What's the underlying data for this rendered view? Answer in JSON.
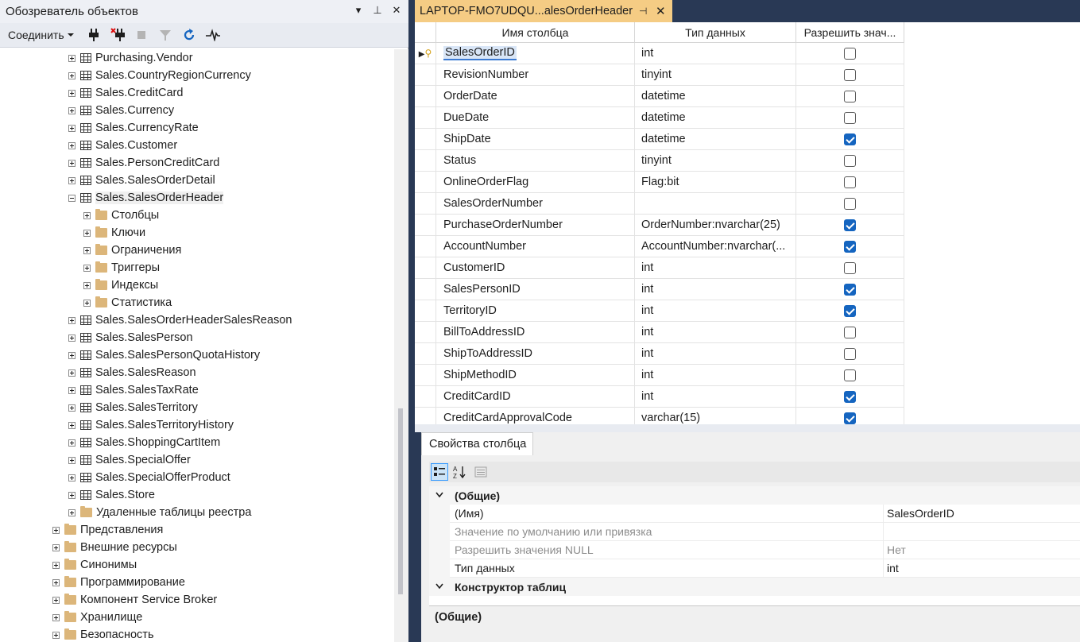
{
  "object_explorer": {
    "title": "Обозреватель объектов",
    "title_actions": [
      "▾",
      "⊥",
      "✕"
    ],
    "toolbar": {
      "connect_label": "Соединить"
    },
    "tree": [
      {
        "label": "Purchasing.Vendor",
        "type": "table",
        "level": 2,
        "expanded": false
      },
      {
        "label": "Sales.CountryRegionCurrency",
        "type": "table",
        "level": 2,
        "expanded": false
      },
      {
        "label": "Sales.CreditCard",
        "type": "table",
        "level": 2,
        "expanded": false
      },
      {
        "label": "Sales.Currency",
        "type": "table",
        "level": 2,
        "expanded": false
      },
      {
        "label": "Sales.CurrencyRate",
        "type": "table",
        "level": 2,
        "expanded": false
      },
      {
        "label": "Sales.Customer",
        "type": "table",
        "level": 2,
        "expanded": false
      },
      {
        "label": "Sales.PersonCreditCard",
        "type": "table",
        "level": 2,
        "expanded": false
      },
      {
        "label": "Sales.SalesOrderDetail",
        "type": "table",
        "level": 2,
        "expanded": false
      },
      {
        "label": "Sales.SalesOrderHeader",
        "type": "table",
        "level": 2,
        "expanded": true,
        "selected": true
      },
      {
        "label": "Столбцы",
        "type": "folder",
        "level": 3,
        "expanded": false
      },
      {
        "label": "Ключи",
        "type": "folder",
        "level": 3,
        "expanded": false
      },
      {
        "label": "Ограничения",
        "type": "folder",
        "level": 3,
        "expanded": false
      },
      {
        "label": "Триггеры",
        "type": "folder",
        "level": 3,
        "expanded": false
      },
      {
        "label": "Индексы",
        "type": "folder",
        "level": 3,
        "expanded": false
      },
      {
        "label": "Статистика",
        "type": "folder",
        "level": 3,
        "expanded": false
      },
      {
        "label": "Sales.SalesOrderHeaderSalesReason",
        "type": "table",
        "level": 2,
        "expanded": false
      },
      {
        "label": "Sales.SalesPerson",
        "type": "table",
        "level": 2,
        "expanded": false
      },
      {
        "label": "Sales.SalesPersonQuotaHistory",
        "type": "table",
        "level": 2,
        "expanded": false
      },
      {
        "label": "Sales.SalesReason",
        "type": "table",
        "level": 2,
        "expanded": false
      },
      {
        "label": "Sales.SalesTaxRate",
        "type": "table",
        "level": 2,
        "expanded": false
      },
      {
        "label": "Sales.SalesTerritory",
        "type": "table",
        "level": 2,
        "expanded": false
      },
      {
        "label": "Sales.SalesTerritoryHistory",
        "type": "table",
        "level": 2,
        "expanded": false
      },
      {
        "label": "Sales.ShoppingCartItem",
        "type": "table",
        "level": 2,
        "expanded": false
      },
      {
        "label": "Sales.SpecialOffer",
        "type": "table",
        "level": 2,
        "expanded": false
      },
      {
        "label": "Sales.SpecialOfferProduct",
        "type": "table",
        "level": 2,
        "expanded": false
      },
      {
        "label": "Sales.Store",
        "type": "table",
        "level": 2,
        "expanded": false
      },
      {
        "label": "Удаленные таблицы реестра",
        "type": "folder",
        "level": 2,
        "expanded": false
      },
      {
        "label": "Представления",
        "type": "folder",
        "level": 1,
        "expanded": false
      },
      {
        "label": "Внешние ресурсы",
        "type": "folder",
        "level": 1,
        "expanded": false
      },
      {
        "label": "Синонимы",
        "type": "folder",
        "level": 1,
        "expanded": false
      },
      {
        "label": "Программирование",
        "type": "folder",
        "level": 1,
        "expanded": false
      },
      {
        "label": "Компонент Service Broker",
        "type": "folder",
        "level": 1,
        "expanded": false
      },
      {
        "label": "Хранилище",
        "type": "folder",
        "level": 1,
        "expanded": false
      },
      {
        "label": "Безопасность",
        "type": "folder",
        "level": 1,
        "expanded": false
      }
    ]
  },
  "document_tab": {
    "title": "LAPTOP-FMO7UDQU...alesOrderHeader",
    "pin_icon": "⊣",
    "close_icon": "✕",
    "accent": "#f5cc84"
  },
  "table_designer": {
    "headers": [
      "Имя столбца",
      "Тип данных",
      "Разрешить знач..."
    ],
    "rows": [
      {
        "name": "SalesOrderID",
        "type": "int",
        "allow_null": false,
        "primary_key": true,
        "editing": true
      },
      {
        "name": "RevisionNumber",
        "type": "tinyint",
        "allow_null": false
      },
      {
        "name": "OrderDate",
        "type": "datetime",
        "allow_null": false
      },
      {
        "name": "DueDate",
        "type": "datetime",
        "allow_null": false
      },
      {
        "name": "ShipDate",
        "type": "datetime",
        "allow_null": true
      },
      {
        "name": "Status",
        "type": "tinyint",
        "allow_null": false
      },
      {
        "name": "OnlineOrderFlag",
        "type": "Flag:bit",
        "allow_null": false
      },
      {
        "name": "SalesOrderNumber",
        "type": "",
        "allow_null": false
      },
      {
        "name": "PurchaseOrderNumber",
        "type": "OrderNumber:nvarchar(25)",
        "allow_null": true
      },
      {
        "name": "AccountNumber",
        "type": "AccountNumber:nvarchar(...",
        "allow_null": true
      },
      {
        "name": "CustomerID",
        "type": "int",
        "allow_null": false
      },
      {
        "name": "SalesPersonID",
        "type": "int",
        "allow_null": true
      },
      {
        "name": "TerritoryID",
        "type": "int",
        "allow_null": true
      },
      {
        "name": "BillToAddressID",
        "type": "int",
        "allow_null": false
      },
      {
        "name": "ShipToAddressID",
        "type": "int",
        "allow_null": false
      },
      {
        "name": "ShipMethodID",
        "type": "int",
        "allow_null": false
      },
      {
        "name": "CreditCardID",
        "type": "int",
        "allow_null": true
      },
      {
        "name": "CreditCardApprovalCode",
        "type": "varchar(15)",
        "allow_null": true
      }
    ]
  },
  "column_properties": {
    "tab_label": "Свойства столбца",
    "rows": [
      {
        "kind": "category",
        "name": "(Общие)"
      },
      {
        "kind": "prop",
        "name": "(Имя)",
        "value": "SalesOrderID",
        "disabled": false
      },
      {
        "kind": "prop",
        "name": "Значение по умолчанию или привязка",
        "value": "",
        "disabled": true
      },
      {
        "kind": "prop",
        "name": "Разрешить значения NULL",
        "value": "Нет",
        "disabled": true
      },
      {
        "kind": "prop",
        "name": "Тип данных",
        "value": "int",
        "disabled": false
      },
      {
        "kind": "category",
        "name": "Конструктор таблиц"
      }
    ],
    "description_title": "(Общие)"
  },
  "colors": {
    "check_blue": "#1565c0",
    "frame": "#293955"
  }
}
